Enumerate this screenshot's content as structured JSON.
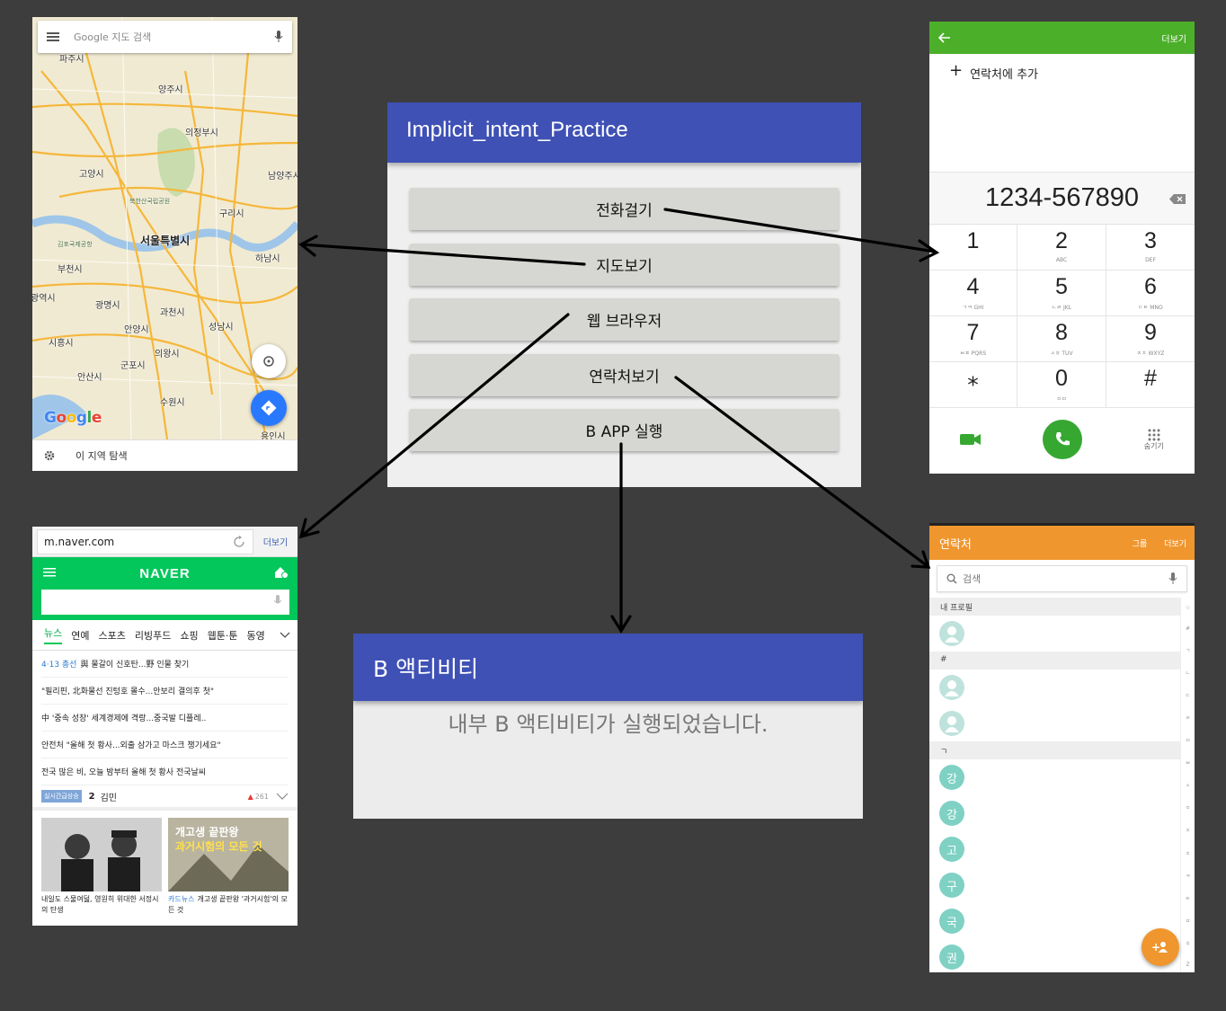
{
  "map": {
    "search_placeholder": "Google 지도 검색",
    "cities": [
      "파주시",
      "양주시",
      "의정부시",
      "고양시",
      "남양주시",
      "북한산국립공원",
      "구리시",
      "김포국제공항",
      "서울특별시",
      "하남시",
      "부천시",
      "광역시",
      "광명시",
      "과천시",
      "안양시",
      "성남시",
      "시흥시",
      "의왕시",
      "군포시",
      "안산시",
      "수원시",
      "용인시"
    ],
    "logo": "Google",
    "explore_label": "이 지역 탐색"
  },
  "main_app": {
    "title": "Implicit_intent_Practice",
    "buttons": [
      "전화걸기",
      "지도보기",
      "웹 브라우저",
      "연락처보기",
      "B APP 실행"
    ]
  },
  "dialer": {
    "more_label": "더보기",
    "add_contact_label": "연락처에 추가",
    "number": "1234-567890",
    "keys": [
      {
        "digit": "1",
        "letters": ""
      },
      {
        "digit": "2",
        "letters": "ABC"
      },
      {
        "digit": "3",
        "letters": "DEF"
      },
      {
        "digit": "4",
        "letters": "ㄱㅋ GHI"
      },
      {
        "digit": "5",
        "letters": "ㄴㄹ JKL"
      },
      {
        "digit": "6",
        "letters": "ㄷㅌ MNO"
      },
      {
        "digit": "7",
        "letters": "ㅂㅍ PQRS"
      },
      {
        "digit": "8",
        "letters": "ㅅㅎ TUV"
      },
      {
        "digit": "9",
        "letters": "ㅈㅊ WXYZ"
      },
      {
        "digit": "⁎",
        "letters": ""
      },
      {
        "digit": "0",
        "letters": "ㅇㅁ"
      },
      {
        "digit": "#",
        "letters": ""
      }
    ],
    "hide_label": "숨기기"
  },
  "naver": {
    "url": "m.naver.com",
    "more_label": "더보기",
    "logo": "NAVER",
    "tabs": [
      "뉴스",
      "연예",
      "스포츠",
      "리빙푸드",
      "쇼핑",
      "웹툰·툰",
      "동영"
    ],
    "news": [
      {
        "tag": "4·13 총선",
        "text": "與 물갈이 신호탄...野 인물 찾기"
      },
      {
        "tag": "",
        "text": "\"필리핀, 北화물선 진텅호 몰수...안보리 결의후 첫\""
      },
      {
        "tag": "",
        "text": "中 '중속 성장' 세계경제에 격랑...중국발 디플레.."
      },
      {
        "tag": "",
        "text": "안전처 \"올해 첫 황사...외출 삼가고 마스크 챙기세요\""
      },
      {
        "tag": "",
        "text": "전국 많은 비, 오늘 밤부터 올해 첫 황사   전국날씨"
      }
    ],
    "keyword_badge": "실시간급상승",
    "keyword_rank": "2",
    "keyword": "김민",
    "keyword_count": "261",
    "captions": [
      {
        "tag": "",
        "text": "내일도 스물여덟, 영원히 위대한 서정시의 탄생"
      },
      {
        "tag": "카드뉴스",
        "text": "개고생 끝판왕 '과거시험'의 모든 것"
      }
    ],
    "photo2_text": "과거시험의 모든 것"
  },
  "b_activity": {
    "title": "B 액티비티",
    "message": "내부 B 액티비티가 실행되었습니다."
  },
  "contacts": {
    "title": "연락처",
    "group_label": "그룹",
    "more_label": "더보기",
    "search_placeholder": "검색",
    "sections": [
      {
        "header": "내 프로필",
        "rows": [
          {
            "type": "img",
            "letter": ""
          }
        ]
      },
      {
        "header": "#",
        "rows": [
          {
            "type": "img",
            "letter": ""
          },
          {
            "type": "img",
            "letter": ""
          }
        ]
      },
      {
        "header": "ㄱ",
        "rows": [
          {
            "type": "txt",
            "letter": "강"
          },
          {
            "type": "txt",
            "letter": "강"
          },
          {
            "type": "txt",
            "letter": "고"
          },
          {
            "type": "txt",
            "letter": "구"
          },
          {
            "type": "txt",
            "letter": "국"
          },
          {
            "type": "txt",
            "letter": "권"
          }
        ]
      }
    ],
    "index": [
      "☆",
      "#",
      "ㄱ",
      "ㄴ",
      "ㄷ",
      "ㄹ",
      "ㅁ",
      "ㅂ",
      "ㅅ",
      "ㅇ",
      "ㅈ",
      "ㅊ",
      "ㅋ",
      "ㅌ",
      "ㅍ",
      "ㅎ",
      "Z"
    ]
  },
  "colors": {
    "background": "#3d3d3d",
    "app_primary": "#3f51b5",
    "dialer_green": "#4caf2a",
    "naver_green": "#03c75a",
    "contacts_orange": "#f0962e"
  }
}
